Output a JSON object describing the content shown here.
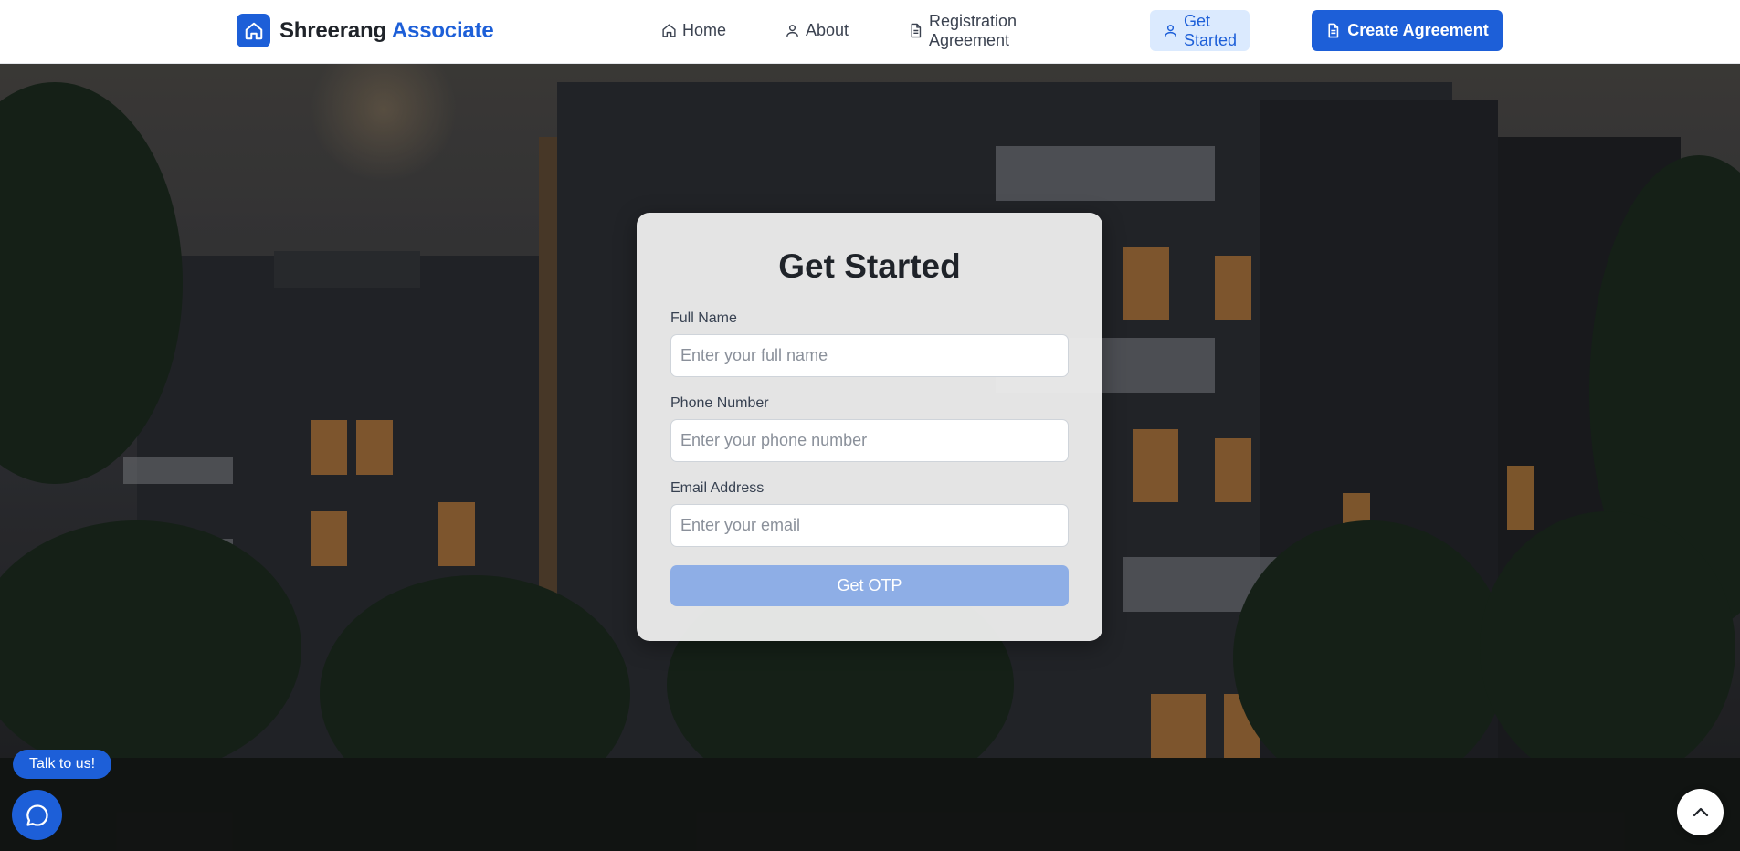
{
  "brand": {
    "name": "Shreerang",
    "accent": "Associate",
    "logo_icon": "home-icon",
    "accent_color": "#1d5fd8"
  },
  "nav": {
    "items": [
      {
        "label": "Home",
        "icon": "home-icon"
      },
      {
        "label": "About",
        "icon": "user-icon"
      },
      {
        "label": "Registration Agreement",
        "icon": "document-icon"
      },
      {
        "label": "Get Started",
        "icon": "user-icon",
        "active": true
      }
    ],
    "cta": {
      "label": "Create Agreement",
      "icon": "document-icon"
    }
  },
  "form": {
    "title": "Get Started",
    "fields": [
      {
        "label": "Full Name",
        "placeholder": "Enter your full name",
        "value": ""
      },
      {
        "label": "Phone Number",
        "placeholder": "Enter your phone number",
        "value": ""
      },
      {
        "label": "Email Address",
        "placeholder": "Enter your email",
        "value": ""
      }
    ],
    "submit_label": "Get OTP"
  },
  "chat": {
    "badge": "Talk to us!",
    "icon": "chat-bubble-icon"
  },
  "scroll_top": {
    "icon": "chevron-up-icon"
  },
  "colors": {
    "primary": "#1d5fd8",
    "active_nav_bg": "#dbeafe",
    "disabled_button": "#8eaee6"
  }
}
